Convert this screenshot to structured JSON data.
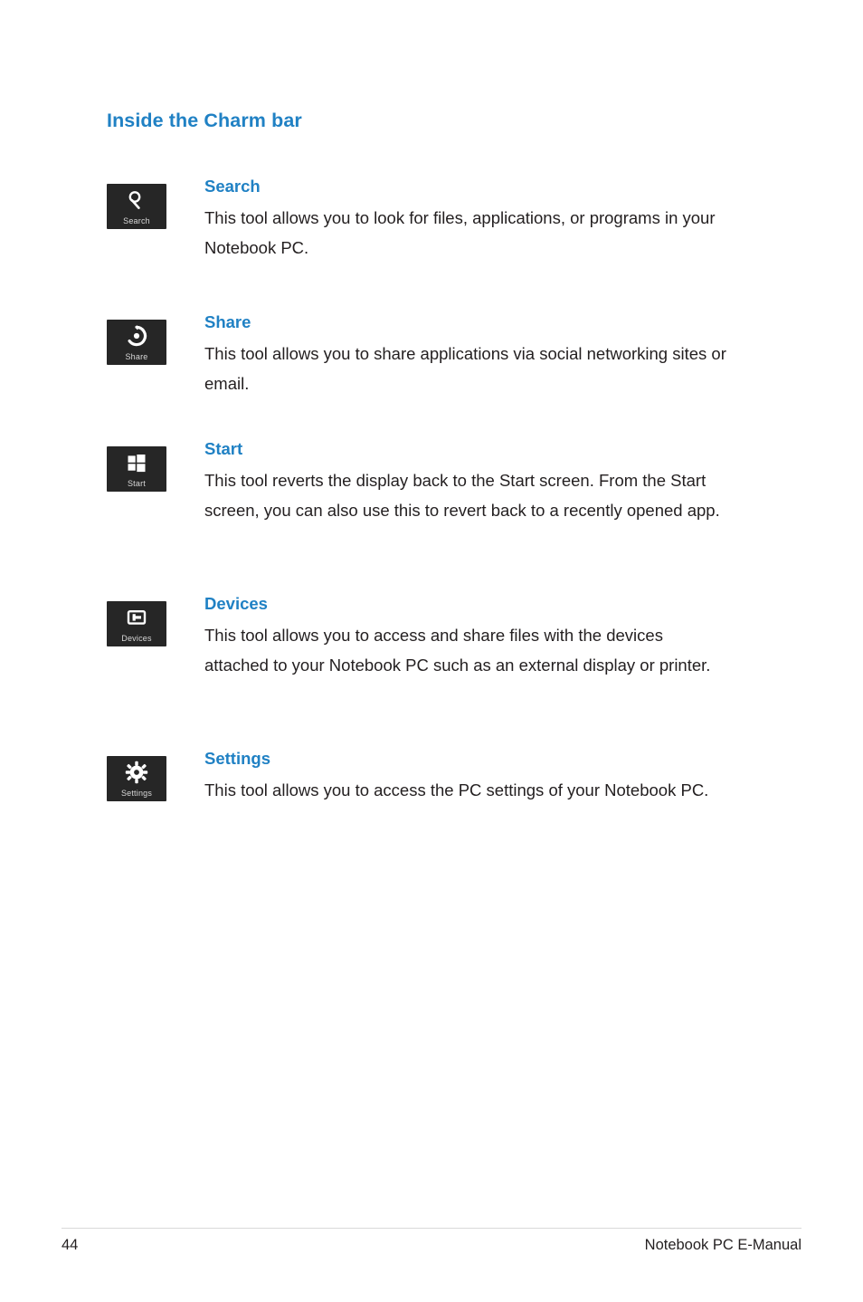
{
  "document": {
    "section_title": "Inside the Charm bar",
    "footer": {
      "page_number": "44",
      "doc_title": "Notebook PC E-Manual"
    },
    "accent_color": "#2081c4",
    "tile_color": "#262626"
  },
  "entries": [
    {
      "icon": "magnifier-icon",
      "tile_label": "Search",
      "title": "Search",
      "body": "This tool allows you to look for files, applications, or programs in your Notebook PC."
    },
    {
      "icon": "share-icon",
      "tile_label": "Share",
      "title": "Share",
      "body": "This tool allows you to share applications via social networking sites or email."
    },
    {
      "icon": "windows-start-icon",
      "tile_label": "Start",
      "title": "Start",
      "body": "This tool reverts the display back to the Start screen. From the Start screen, you can also use this to revert back to a recently opened app."
    },
    {
      "icon": "devices-icon",
      "tile_label": "Devices",
      "title": "Devices",
      "body": "This tool allows you to access and share files with the devices attached to your Notebook PC such as an external display or printer."
    },
    {
      "icon": "gear-icon",
      "tile_label": "Settings",
      "title": "Settings",
      "body": "This tool allows you to access the PC settings of your Notebook PC."
    }
  ]
}
